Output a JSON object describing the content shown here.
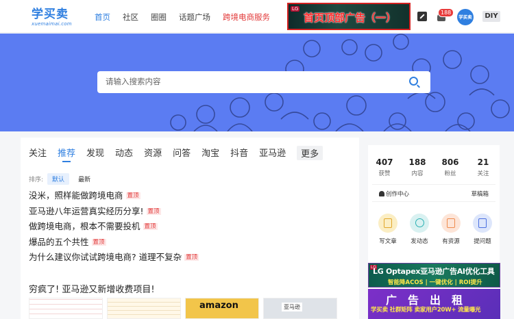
{
  "header": {
    "logo_main": "学买卖",
    "logo_sub": "xuemaimai.com",
    "nav": [
      {
        "label": "首页",
        "active": true
      },
      {
        "label": "社区",
        "active": false
      },
      {
        "label": "圈圈",
        "active": false
      },
      {
        "label": "话题广场",
        "active": false
      },
      {
        "label": "跨境电商服务",
        "active": false,
        "highlight": true
      }
    ],
    "top_ad_text": "首页顶部广告（一）",
    "notification_count": "188",
    "avatar_label": "学买卖",
    "diy_label": "DIY"
  },
  "search": {
    "placeholder": "请输入搜索内容"
  },
  "feed": {
    "tabs": [
      "关注",
      "推荐",
      "发现",
      "动态",
      "资源",
      "问答",
      "淘宝",
      "抖音",
      "亚马逊",
      "更多"
    ],
    "active_tab": "推荐",
    "sort_label": "排序:",
    "sort_options": [
      "默认",
      "最新"
    ],
    "pinned_posts": [
      {
        "title": "没米，照样能做跨境电商",
        "tag": "置顶"
      },
      {
        "title": "亚马逊八年运营真实经历分享!",
        "tag": "置顶"
      },
      {
        "title": "做跨境电商，根本不需要投机",
        "tag": "置顶"
      },
      {
        "title": "爆品的五个共性",
        "tag": "置顶"
      },
      {
        "title": "为什么建议你试试跨境电商? 道理不复杂",
        "tag": "置顶"
      }
    ],
    "featured_title": "穷疯了! 亚马逊又新增收费项目!",
    "thumbnails": [
      {
        "label": ""
      },
      {
        "label": ""
      },
      {
        "label": "amazon"
      },
      {
        "label": "亚马逊"
      }
    ]
  },
  "profile": {
    "stats": [
      {
        "value": "407",
        "label": "获赞"
      },
      {
        "value": "188",
        "label": "内容"
      },
      {
        "value": "806",
        "label": "粉丝"
      },
      {
        "value": "21",
        "label": "关注"
      }
    ],
    "creator_center": "创作中心",
    "drafts": "草稿箱",
    "actions": [
      {
        "label": "写文章",
        "icon": "document-icon"
      },
      {
        "label": "发动态",
        "icon": "hash-icon"
      },
      {
        "label": "有资源",
        "icon": "resource-icon"
      },
      {
        "label": "提问题",
        "icon": "question-icon"
      }
    ]
  },
  "ads": {
    "ad1_line1": "LG Optapex亚马逊广告AI优化工具",
    "ad1_line2": "智能降ACOS | 一键优化 | ROI提升",
    "ad2_line1": "广告出租",
    "ad2_line2": "学买卖 社群矩阵 卖家用户20W+ 流量曝光"
  }
}
